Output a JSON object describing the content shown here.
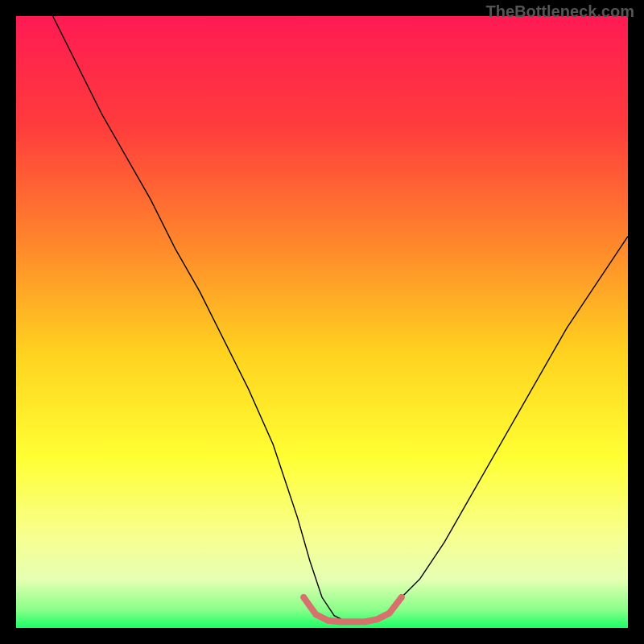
{
  "watermark": "TheBottleneck.com",
  "chart_data": {
    "type": "line",
    "title": "",
    "xlabel": "",
    "ylabel": "",
    "xlim": [
      0,
      100
    ],
    "ylim": [
      0,
      100
    ],
    "gradient_stops": [
      {
        "offset": 0,
        "color": "#ff1a53"
      },
      {
        "offset": 18,
        "color": "#ff3c3c"
      },
      {
        "offset": 38,
        "color": "#ff8a2b"
      },
      {
        "offset": 55,
        "color": "#ffd21f"
      },
      {
        "offset": 72,
        "color": "#ffff33"
      },
      {
        "offset": 85,
        "color": "#f7ff8f"
      },
      {
        "offset": 92,
        "color": "#e6ffb3"
      },
      {
        "offset": 97,
        "color": "#8aff8a"
      },
      {
        "offset": 100,
        "color": "#1aff66"
      }
    ],
    "series": [
      {
        "name": "bottleneck-curve",
        "stroke": "#000000",
        "stroke_width": 1.4,
        "x": [
          6,
          10,
          14,
          18,
          22,
          26,
          30,
          34,
          38,
          42,
          46,
          48,
          50,
          52,
          54,
          56,
          58,
          60,
          62,
          66,
          70,
          74,
          78,
          82,
          86,
          90,
          94,
          98,
          100
        ],
        "y": [
          100,
          92,
          84,
          77,
          70,
          62,
          55,
          47,
          39,
          30,
          18,
          11,
          5,
          2,
          1,
          1,
          1,
          2,
          4,
          8,
          14,
          21,
          28,
          35,
          42,
          49,
          55,
          61,
          64
        ]
      },
      {
        "name": "optimal-zone",
        "stroke": "#d6716e",
        "stroke_width": 8,
        "linecap": "round",
        "x": [
          47,
          49,
          51,
          53,
          55,
          57,
          59,
          61,
          63
        ],
        "y": [
          5,
          2.2,
          1.2,
          1,
          1,
          1,
          1.4,
          2.4,
          5
        ]
      }
    ],
    "markers": {
      "name": "optimal-zone-dots",
      "fill": "#d6716e",
      "radius": 4,
      "x": [
        47,
        49,
        51,
        53,
        55,
        57,
        59,
        61,
        63
      ],
      "y": [
        5,
        2.2,
        1.2,
        1,
        1,
        1,
        1.4,
        2.4,
        5
      ]
    }
  }
}
